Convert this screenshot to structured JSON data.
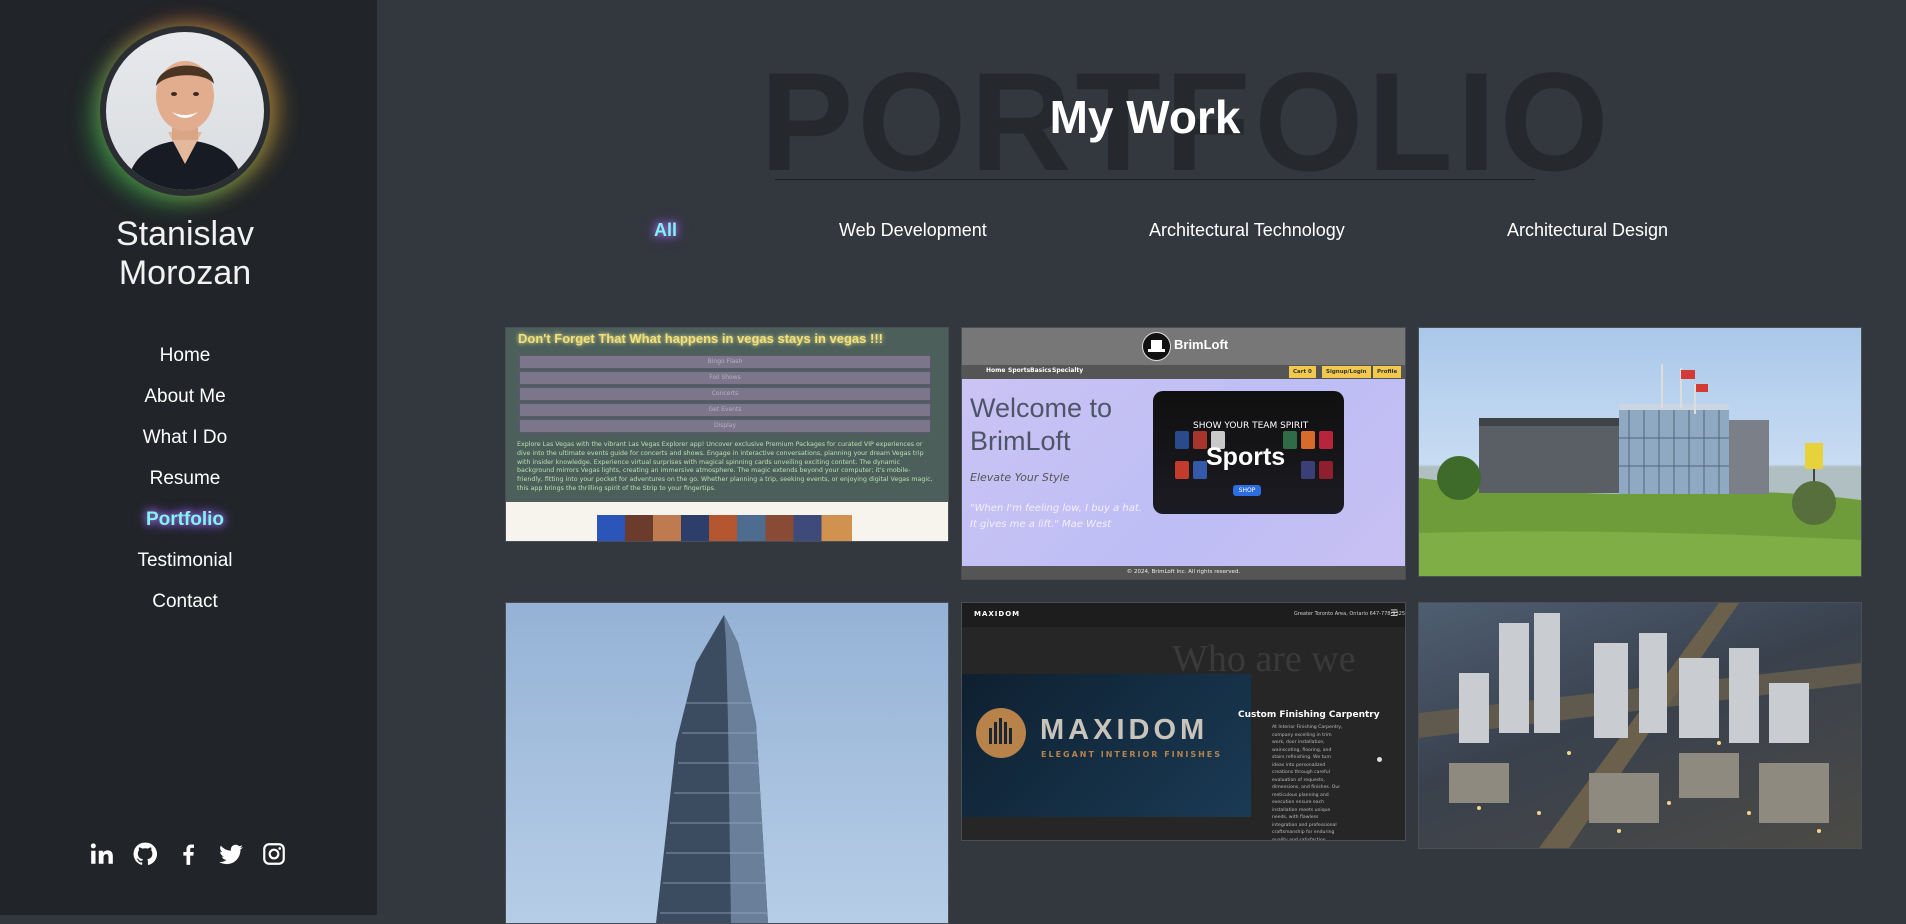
{
  "sidebar": {
    "name_line1": "Stanislav",
    "name_line2": "Morozan",
    "nav": [
      {
        "label": "Home",
        "active": false
      },
      {
        "label": "About Me",
        "active": false
      },
      {
        "label": "What I Do",
        "active": false
      },
      {
        "label": "Resume",
        "active": false
      },
      {
        "label": "Portfolio",
        "active": true
      },
      {
        "label": "Testimonial",
        "active": false
      },
      {
        "label": "Contact",
        "active": false
      }
    ],
    "social": [
      "linkedin-icon",
      "github-icon",
      "facebook-icon",
      "twitter-icon",
      "instagram-icon"
    ]
  },
  "main": {
    "background_word": "PORTFOLIO",
    "title": "My Work",
    "filters": [
      {
        "label": "All",
        "active": true
      },
      {
        "label": "Web Development",
        "active": false
      },
      {
        "label": "Architectural Technology",
        "active": false
      },
      {
        "label": "Architectural Design",
        "active": false
      }
    ]
  },
  "cards": {
    "vegas": {
      "heading": "Don't Forget That What happens in vegas stays in vegas !!!",
      "menu": [
        "Bingo Flash",
        "Foil Shows",
        "Concerts",
        "Get Events",
        "Display"
      ],
      "body": "Explore Las Vegas with the vibrant Las Vegas Explorer app! Uncover exclusive Premium Packages for curated VIP experiences or dive into the ultimate events guide for concerts and shows. Engage in interactive conversations, planning your dream Vegas trip with insider knowledge. Experience virtual surprises with magical spinning cards unveiling exciting content. The dynamic background mirrors Vegas lights, creating an immersive atmosphere. The magic extends beyond your computer; it's mobile-friendly, fitting into your pocket for adventures on the go. Whether planning a trip, seeking events, or enjoying digital Vegas magic, this app brings the thrilling spirit of the Strip to your fingertips."
    },
    "brimloft": {
      "logo": "BrimLoft",
      "nav": [
        "Home",
        "Sports",
        "Basics",
        "Specialty"
      ],
      "buttons": [
        "Cart 0",
        "Signup/Login",
        "Profile"
      ],
      "welcome": "Welcome to BrimLoft",
      "tagline": "Elevate Your Style",
      "quote": "\"When I'm feeling low, I buy a hat. It gives me a lift.\" Mae West",
      "promo_label": "SHOW YOUR TEAM SPIRIT",
      "promo_title": "Sports",
      "promo_button": "SHOP",
      "footer": "© 2024, BrimLoft Inc. All rights reserved."
    },
    "maxidom": {
      "logo": "MAXIDOM",
      "phone": "Greater Toronto Area, Ontario     647-778-9325",
      "menu": "☰",
      "who": "Who are we",
      "banner_word": "MAXIDOM",
      "banner_sub": "ELEGANT INTERIOR FINISHES",
      "heading": "Custom Finishing Carpentry",
      "paragraph": "At Interior Finishing Carpentry, company excelling in trim work, door installation, wainscoting, flooring, and stairs refinishing. We turn ideas into personalized creations through careful evaluation of requests, dimensions, and finishes. Our meticulous planning and execution ensure each installation meets unique needs, with flawless integration and professional craftsmanship for enduring quality and satisfaction."
    }
  },
  "colors": {
    "sidebar_bg": "#212428",
    "main_bg": "#33373e",
    "accent": "#7ff5f0",
    "glow": "#b67bff"
  }
}
